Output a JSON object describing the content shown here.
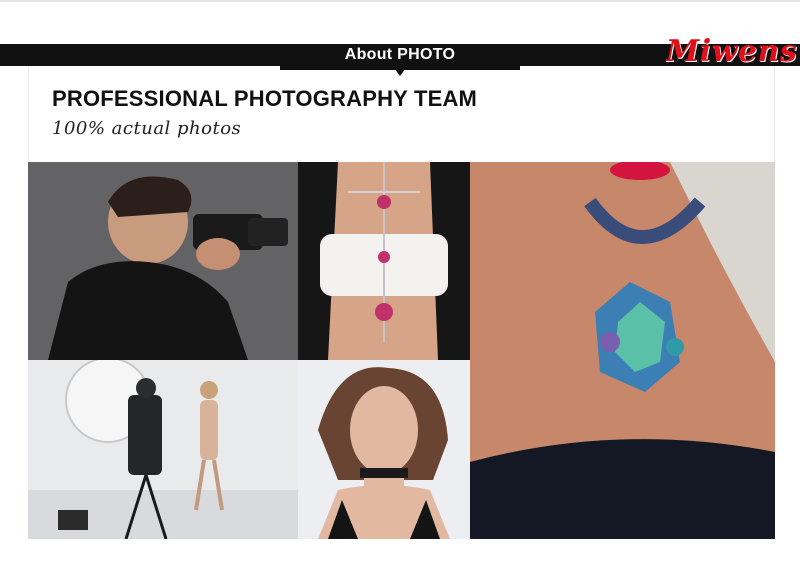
{
  "header": {
    "tab_title": "About  PHOTO",
    "brand": "Miwens"
  },
  "section": {
    "heading": "PROFESSIONAL PHOTOGRAPHY TEAM",
    "subheading": "100% actual photos"
  },
  "photos": [
    {
      "subject": "photographer with camera"
    },
    {
      "subject": "body chain jewelry"
    },
    {
      "subject": "crystal statement necklace"
    },
    {
      "subject": "studio photo shoot"
    },
    {
      "subject": "model wearing choker"
    }
  ],
  "colors": {
    "header_bar": "#111111",
    "brand_red": "#e10f1a",
    "heading_text": "#111111"
  }
}
